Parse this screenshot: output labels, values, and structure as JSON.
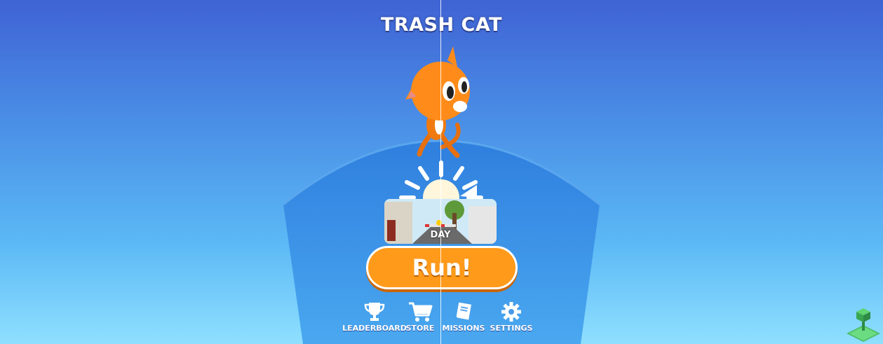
{
  "game": {
    "title": "TRASH CAT"
  },
  "theme": {
    "label": "DAY"
  },
  "run": {
    "label": "Run!"
  },
  "nav": {
    "leaderboard": "LEADERBOARD",
    "store": "STORE",
    "missions": "MISSIONS",
    "settings": "SETTINGS"
  },
  "icons": [
    "trophy-icon",
    "cart-icon",
    "book-icon",
    "gear-icon",
    "sun-icon",
    "arrow-right-icon"
  ],
  "colors": {
    "background_top": "#3f63d4",
    "background_bottom": "#8fe0ff",
    "arena": "#3b8fe3",
    "run_button": "#ff9a1a",
    "cat": "#ff8c1a"
  }
}
